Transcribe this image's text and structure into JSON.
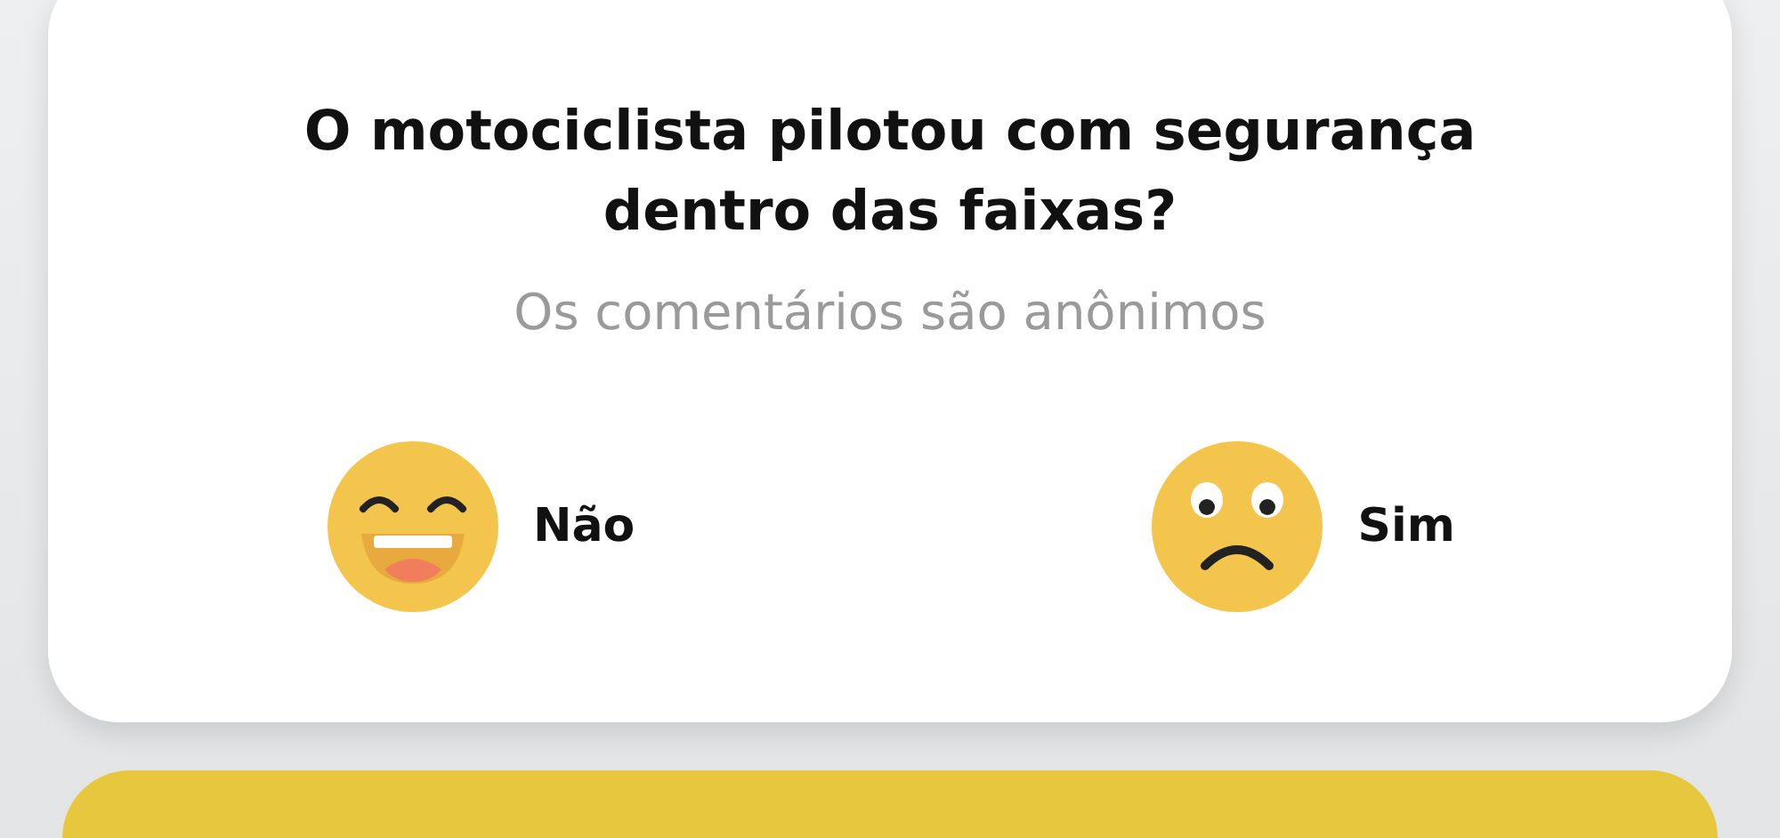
{
  "question": {
    "title": "O motociclista pilotou com segurança dentro das faixas?",
    "subtitle": "Os comentários são anônimos"
  },
  "options": [
    {
      "kind": "happy",
      "label": "Não"
    },
    {
      "kind": "sad",
      "label": "Sim"
    }
  ]
}
